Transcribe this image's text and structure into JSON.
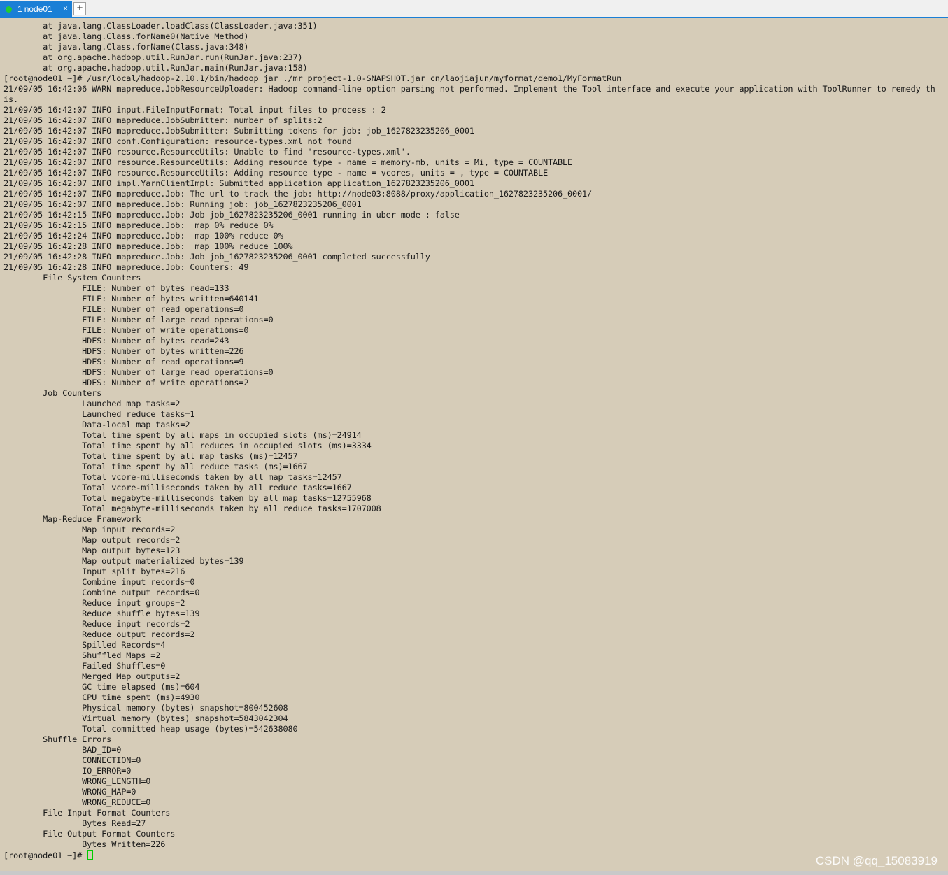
{
  "tabs": [
    {
      "number": "1",
      "label": "node01",
      "close": "×",
      "status_color": "#22cc33"
    }
  ],
  "new_tab_label": "+",
  "terminal": {
    "lines": [
      "        at java.lang.ClassLoader.loadClass(ClassLoader.java:351)",
      "        at java.lang.Class.forName0(Native Method)",
      "        at java.lang.Class.forName(Class.java:348)",
      "        at org.apache.hadoop.util.RunJar.run(RunJar.java:237)",
      "        at org.apache.hadoop.util.RunJar.main(RunJar.java:158)",
      "[root@node01 ~]# /usr/local/hadoop-2.10.1/bin/hadoop jar ./mr_project-1.0-SNAPSHOT.jar cn/laojiajun/myformat/demo1/MyFormatRun",
      "21/09/05 16:42:06 WARN mapreduce.JobResourceUploader: Hadoop command-line option parsing not performed. Implement the Tool interface and execute your application with ToolRunner to remedy th",
      "is.",
      "21/09/05 16:42:07 INFO input.FileInputFormat: Total input files to process : 2",
      "21/09/05 16:42:07 INFO mapreduce.JobSubmitter: number of splits:2",
      "21/09/05 16:42:07 INFO mapreduce.JobSubmitter: Submitting tokens for job: job_1627823235206_0001",
      "21/09/05 16:42:07 INFO conf.Configuration: resource-types.xml not found",
      "21/09/05 16:42:07 INFO resource.ResourceUtils: Unable to find 'resource-types.xml'.",
      "21/09/05 16:42:07 INFO resource.ResourceUtils: Adding resource type - name = memory-mb, units = Mi, type = COUNTABLE",
      "21/09/05 16:42:07 INFO resource.ResourceUtils: Adding resource type - name = vcores, units = , type = COUNTABLE",
      "21/09/05 16:42:07 INFO impl.YarnClientImpl: Submitted application application_1627823235206_0001",
      "21/09/05 16:42:07 INFO mapreduce.Job: The url to track the job: http://node03:8088/proxy/application_1627823235206_0001/",
      "21/09/05 16:42:07 INFO mapreduce.Job: Running job: job_1627823235206_0001",
      "21/09/05 16:42:15 INFO mapreduce.Job: Job job_1627823235206_0001 running in uber mode : false",
      "21/09/05 16:42:15 INFO mapreduce.Job:  map 0% reduce 0%",
      "21/09/05 16:42:24 INFO mapreduce.Job:  map 100% reduce 0%",
      "21/09/05 16:42:28 INFO mapreduce.Job:  map 100% reduce 100%",
      "21/09/05 16:42:28 INFO mapreduce.Job: Job job_1627823235206_0001 completed successfully",
      "21/09/05 16:42:28 INFO mapreduce.Job: Counters: 49",
      "        File System Counters",
      "                FILE: Number of bytes read=133",
      "                FILE: Number of bytes written=640141",
      "                FILE: Number of read operations=0",
      "                FILE: Number of large read operations=0",
      "                FILE: Number of write operations=0",
      "                HDFS: Number of bytes read=243",
      "                HDFS: Number of bytes written=226",
      "                HDFS: Number of read operations=9",
      "                HDFS: Number of large read operations=0",
      "                HDFS: Number of write operations=2",
      "        Job Counters",
      "                Launched map tasks=2",
      "                Launched reduce tasks=1",
      "                Data-local map tasks=2",
      "                Total time spent by all maps in occupied slots (ms)=24914",
      "                Total time spent by all reduces in occupied slots (ms)=3334",
      "                Total time spent by all map tasks (ms)=12457",
      "                Total time spent by all reduce tasks (ms)=1667",
      "                Total vcore-milliseconds taken by all map tasks=12457",
      "                Total vcore-milliseconds taken by all reduce tasks=1667",
      "                Total megabyte-milliseconds taken by all map tasks=12755968",
      "                Total megabyte-milliseconds taken by all reduce tasks=1707008",
      "        Map-Reduce Framework",
      "                Map input records=2",
      "                Map output records=2",
      "                Map output bytes=123",
      "                Map output materialized bytes=139",
      "                Input split bytes=216",
      "                Combine input records=0",
      "                Combine output records=0",
      "                Reduce input groups=2",
      "                Reduce shuffle bytes=139",
      "                Reduce input records=2",
      "                Reduce output records=2",
      "                Spilled Records=4",
      "                Shuffled Maps =2",
      "                Failed Shuffles=0",
      "                Merged Map outputs=2",
      "                GC time elapsed (ms)=604",
      "                CPU time spent (ms)=4930",
      "                Physical memory (bytes) snapshot=800452608",
      "                Virtual memory (bytes) snapshot=5843042304",
      "                Total committed heap usage (bytes)=542638080",
      "        Shuffle Errors",
      "                BAD_ID=0",
      "                CONNECTION=0",
      "                IO_ERROR=0",
      "                WRONG_LENGTH=0",
      "                WRONG_MAP=0",
      "                WRONG_REDUCE=0",
      "        File Input Format Counters",
      "                Bytes Read=27",
      "        File Output Format Counters",
      "                Bytes Written=226"
    ],
    "prompt": "[root@node01 ~]# "
  },
  "watermark": "CSDN @qq_15083919",
  "colors": {
    "terminal_bg": "#d6ccb8",
    "tab_active": "#1a7fd6",
    "cursor": "#00cc00"
  }
}
